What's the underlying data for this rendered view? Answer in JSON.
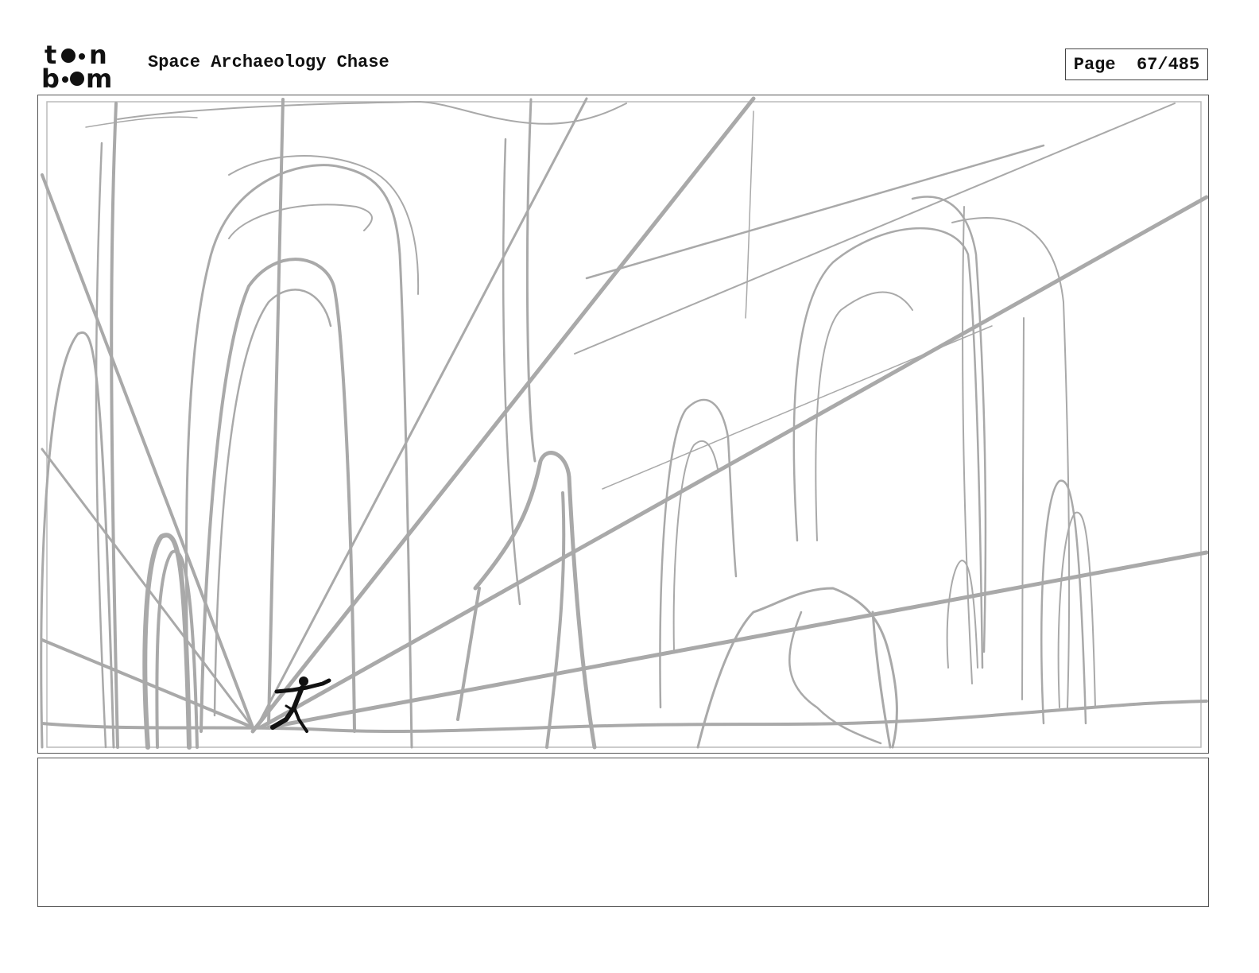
{
  "header": {
    "logo_text": "toonboom",
    "project_title": "Space Archaeology Chase",
    "page_label": "Page",
    "page_number": "67/485"
  },
  "panel": {
    "sketch_color": "#a9a9a9",
    "figure_color": "#111111"
  },
  "notes": {
    "text": ""
  }
}
